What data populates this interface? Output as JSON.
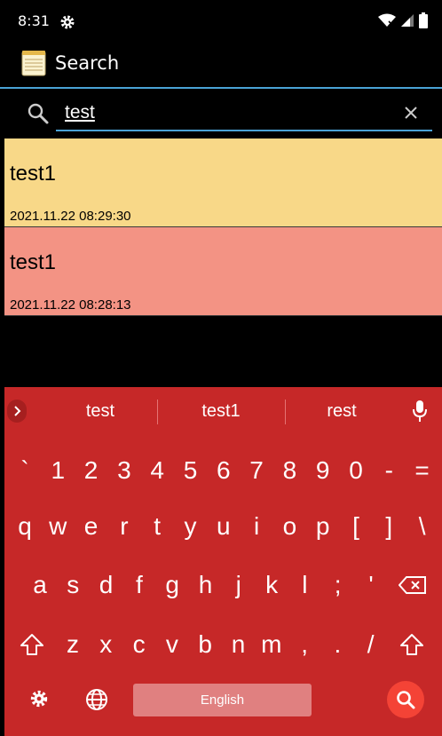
{
  "status_bar": {
    "time": "8:31"
  },
  "app_bar": {
    "title": "Search"
  },
  "search": {
    "value": "test"
  },
  "notes": [
    {
      "title": "test1",
      "date": "2021.11.22 08:29:30",
      "color": "#f8d888"
    },
    {
      "title": "test1",
      "date": "2021.11.22 08:28:13",
      "color": "#f39384"
    }
  ],
  "keyboard": {
    "suggestions": [
      "test",
      "test1",
      "rest"
    ],
    "rows": [
      [
        "`",
        "1",
        "2",
        "3",
        "4",
        "5",
        "6",
        "7",
        "8",
        "9",
        "0",
        "-",
        "="
      ],
      [
        "q",
        "w",
        "e",
        "r",
        "t",
        "y",
        "u",
        "i",
        "o",
        "p",
        "[",
        "]",
        "\\"
      ],
      [
        "a",
        "s",
        "d",
        "f",
        "g",
        "h",
        "j",
        "k",
        "l",
        ";",
        "'"
      ],
      [
        "z",
        "x",
        "c",
        "v",
        "b",
        "n",
        "m",
        ",",
        ".",
        "/"
      ]
    ],
    "space_label": "English",
    "color": "#c62828"
  }
}
